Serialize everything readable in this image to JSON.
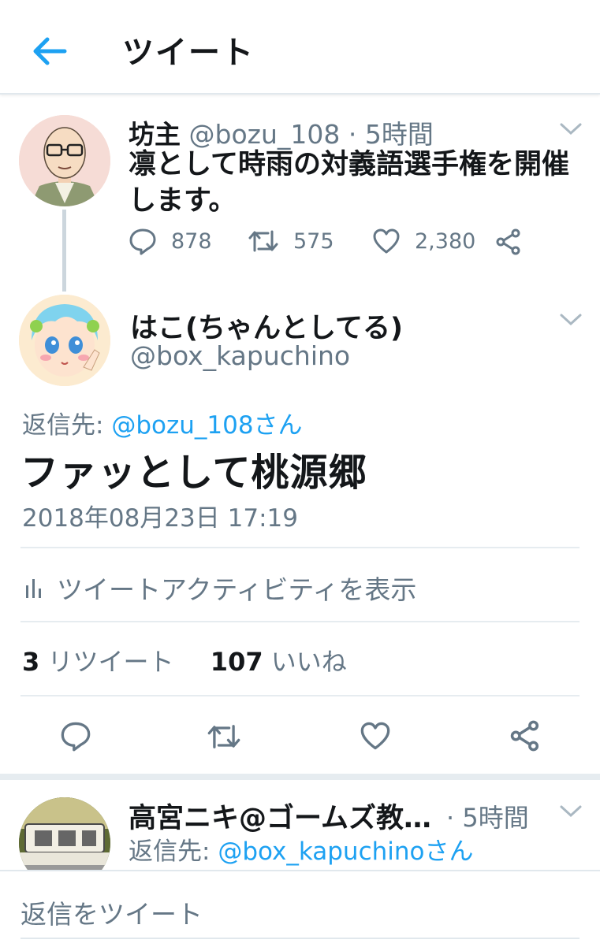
{
  "header": {
    "title": "ツイート",
    "back_icon": "arrow-left-icon"
  },
  "colors": {
    "accent": "#1da1f2",
    "text": "#14171a",
    "muted": "#657786",
    "divider": "#e6ecf0"
  },
  "tweet1": {
    "name": "坊主",
    "handle": "@bozu_108",
    "separator": "·",
    "time": "5時間",
    "text": "凛として時雨の対義語選手権を開催します。",
    "replies": "878",
    "retweets": "575",
    "likes": "2,380"
  },
  "main_tweet": {
    "name": "はこ(ちゃんとしてる)",
    "handle": "@box_kapuchino",
    "reply_label": "返信先:",
    "reply_target": "@bozu_108さん",
    "text": "ファッとして桃源郷",
    "timestamp": "2018年08月23日 17:19",
    "activity_label": "ツイートアクティビティを表示",
    "retweet_count": "3",
    "retweet_label": "リツイート",
    "like_count": "107",
    "like_label": "いいね"
  },
  "tweet3": {
    "name": "高宮ニキ@ゴームズ教…",
    "separator": "·",
    "time": "5時間",
    "reply_label": "返信先:",
    "reply_target": "@box_kapuchinoさん"
  },
  "compose": {
    "placeholder": "返信をツイート"
  }
}
